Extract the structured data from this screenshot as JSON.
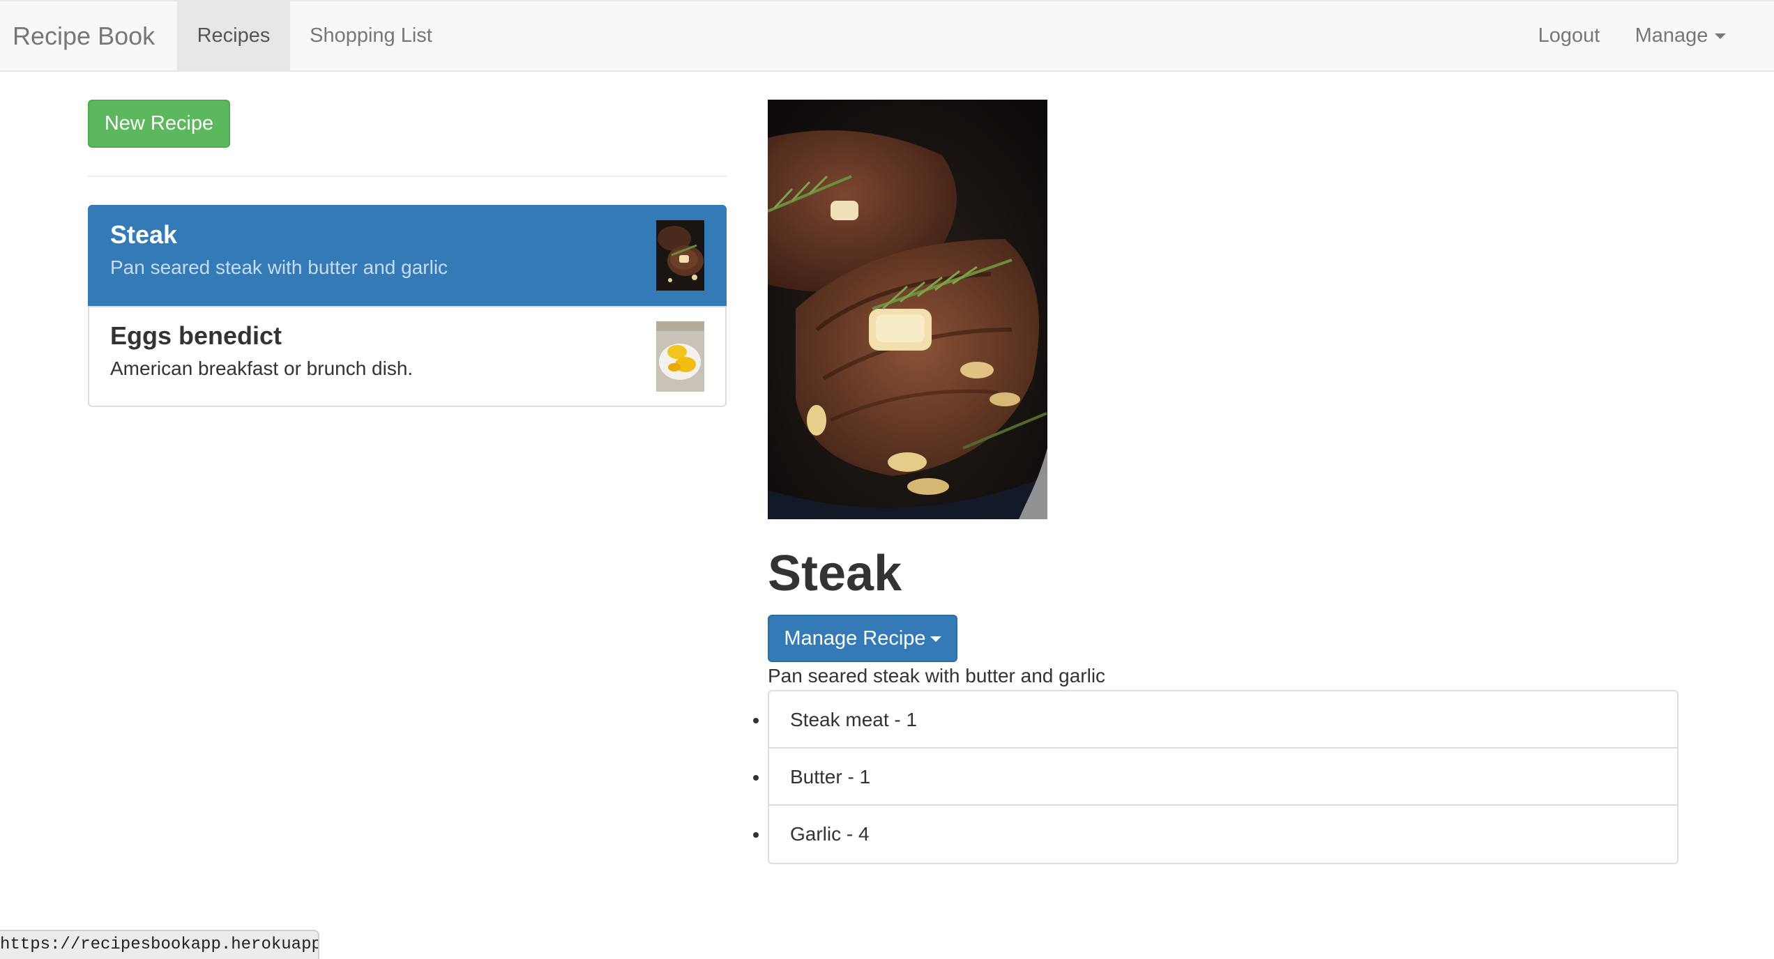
{
  "navbar": {
    "brand": "Recipe Book",
    "tabs": [
      {
        "label": "Recipes",
        "active": true
      },
      {
        "label": "Shopping List",
        "active": false
      }
    ],
    "logout_label": "Logout",
    "manage_label": "Manage"
  },
  "sidebar": {
    "new_recipe_label": "New Recipe",
    "recipes": [
      {
        "name": "Steak",
        "description": "Pan seared steak with butter and garlic",
        "image_icon": "steak-photo",
        "active": true
      },
      {
        "name": "Eggs benedict",
        "description": "American breakfast or brunch dish.",
        "image_icon": "eggs-benedict-photo",
        "active": false
      }
    ]
  },
  "detail": {
    "image_icon": "steak-photo",
    "title": "Steak",
    "manage_recipe_label": "Manage Recipe",
    "description": "Pan seared steak with butter and garlic",
    "ingredients": [
      {
        "text": "Steak meat - 1"
      },
      {
        "text": "Butter - 1"
      },
      {
        "text": "Garlic - 4"
      }
    ]
  },
  "statusbar": {
    "url": "https://recipesbookapp.herokuapp.com"
  },
  "colors": {
    "primary": "#337ab7",
    "success": "#5cb85c",
    "navbar_bg": "#f8f8f8",
    "active_tab_bg": "#e7e7e7"
  }
}
